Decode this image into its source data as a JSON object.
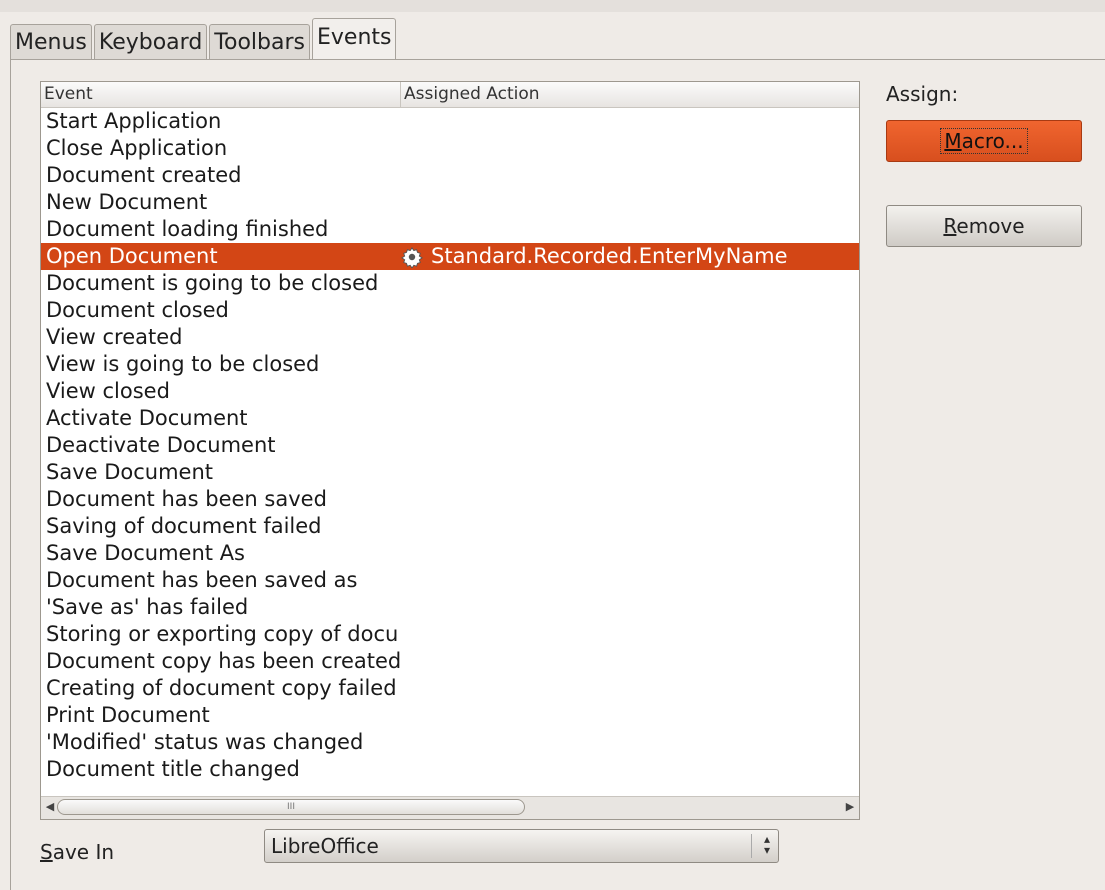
{
  "tabs": [
    "Menus",
    "Keyboard",
    "Toolbars",
    "Events"
  ],
  "active_tab": "Events",
  "list": {
    "headers": {
      "event": "Event",
      "action": "Assigned Action"
    },
    "rows": [
      {
        "event": "Start Application",
        "action": ""
      },
      {
        "event": "Close Application",
        "action": ""
      },
      {
        "event": "Document created",
        "action": ""
      },
      {
        "event": "New Document",
        "action": ""
      },
      {
        "event": "Document loading finished",
        "action": ""
      },
      {
        "event": "Open Document",
        "action": "Standard.Recorded.EnterMyName",
        "selected": true
      },
      {
        "event": "Document is going to be closed",
        "action": ""
      },
      {
        "event": "Document closed",
        "action": ""
      },
      {
        "event": "View created",
        "action": ""
      },
      {
        "event": "View is going to be closed",
        "action": ""
      },
      {
        "event": "View closed",
        "action": ""
      },
      {
        "event": "Activate Document",
        "action": ""
      },
      {
        "event": "Deactivate Document",
        "action": ""
      },
      {
        "event": "Save Document",
        "action": ""
      },
      {
        "event": "Document has been saved",
        "action": ""
      },
      {
        "event": "Saving of document failed",
        "action": ""
      },
      {
        "event": "Save Document As",
        "action": ""
      },
      {
        "event": "Document has been saved as",
        "action": ""
      },
      {
        "event": "'Save as' has failed",
        "action": ""
      },
      {
        "event": "Storing or exporting copy of docu",
        "action": ""
      },
      {
        "event": "Document copy has been created",
        "action": ""
      },
      {
        "event": "Creating of document copy failed",
        "action": ""
      },
      {
        "event": "Print Document",
        "action": ""
      },
      {
        "event": "'Modified' status was changed",
        "action": ""
      },
      {
        "event": "Document title changed",
        "action": ""
      }
    ],
    "scroll_thumb_glyph": "III"
  },
  "assign": {
    "label": "Assign:",
    "macro_button": "Macro...",
    "remove_button": "Remove"
  },
  "save_in": {
    "label": "Save In",
    "value": "LibreOffice"
  },
  "colors": {
    "selection": "#d34615",
    "accent_button": "#e95a25"
  }
}
